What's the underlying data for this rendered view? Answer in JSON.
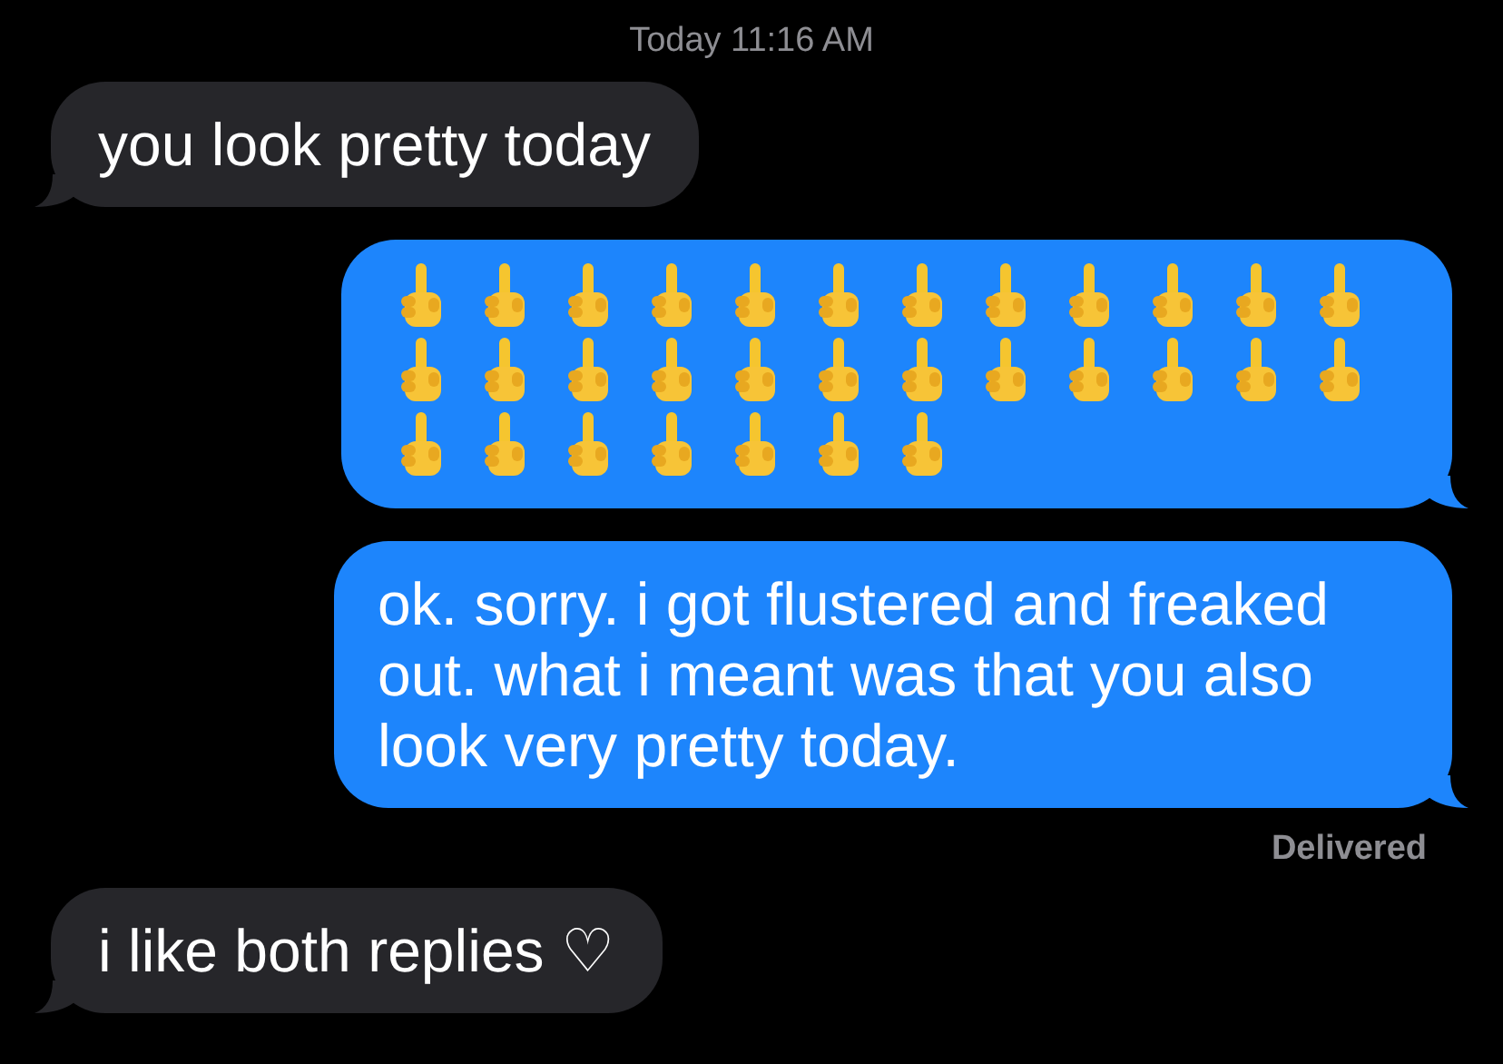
{
  "timestamp": "Today 11:16 AM",
  "messages": [
    {
      "kind": "text",
      "outgoing": false,
      "text": "you look pretty today"
    },
    {
      "kind": "emoji",
      "outgoing": true,
      "emoji": [
        {
          "kind": "middle_finger"
        },
        {
          "kind": "middle_finger"
        },
        {
          "kind": "middle_finger"
        },
        {
          "kind": "middle_finger"
        },
        {
          "kind": "middle_finger"
        },
        {
          "kind": "middle_finger"
        },
        {
          "kind": "middle_finger"
        },
        {
          "kind": "middle_finger"
        },
        {
          "kind": "middle_finger"
        },
        {
          "kind": "middle_finger"
        },
        {
          "kind": "middle_finger"
        },
        {
          "kind": "middle_finger"
        },
        {
          "kind": "middle_finger"
        },
        {
          "kind": "middle_finger"
        },
        {
          "kind": "middle_finger"
        },
        {
          "kind": "middle_finger"
        },
        {
          "kind": "middle_finger"
        },
        {
          "kind": "middle_finger"
        },
        {
          "kind": "middle_finger"
        },
        {
          "kind": "middle_finger"
        },
        {
          "kind": "middle_finger"
        },
        {
          "kind": "middle_finger"
        },
        {
          "kind": "middle_finger"
        },
        {
          "kind": "middle_finger"
        },
        {
          "kind": "middle_finger"
        },
        {
          "kind": "middle_finger"
        },
        {
          "kind": "middle_finger"
        },
        {
          "kind": "middle_finger"
        },
        {
          "kind": "middle_finger"
        },
        {
          "kind": "middle_finger"
        },
        {
          "kind": "middle_finger"
        }
      ]
    },
    {
      "kind": "text",
      "outgoing": true,
      "text": "ok. sorry. i got flustered and freaked out. what i meant was that you also look very pretty today."
    },
    {
      "kind": "status",
      "text": "Delivered"
    },
    {
      "kind": "text",
      "outgoing": false,
      "text": "i like both replies ♡"
    }
  ]
}
